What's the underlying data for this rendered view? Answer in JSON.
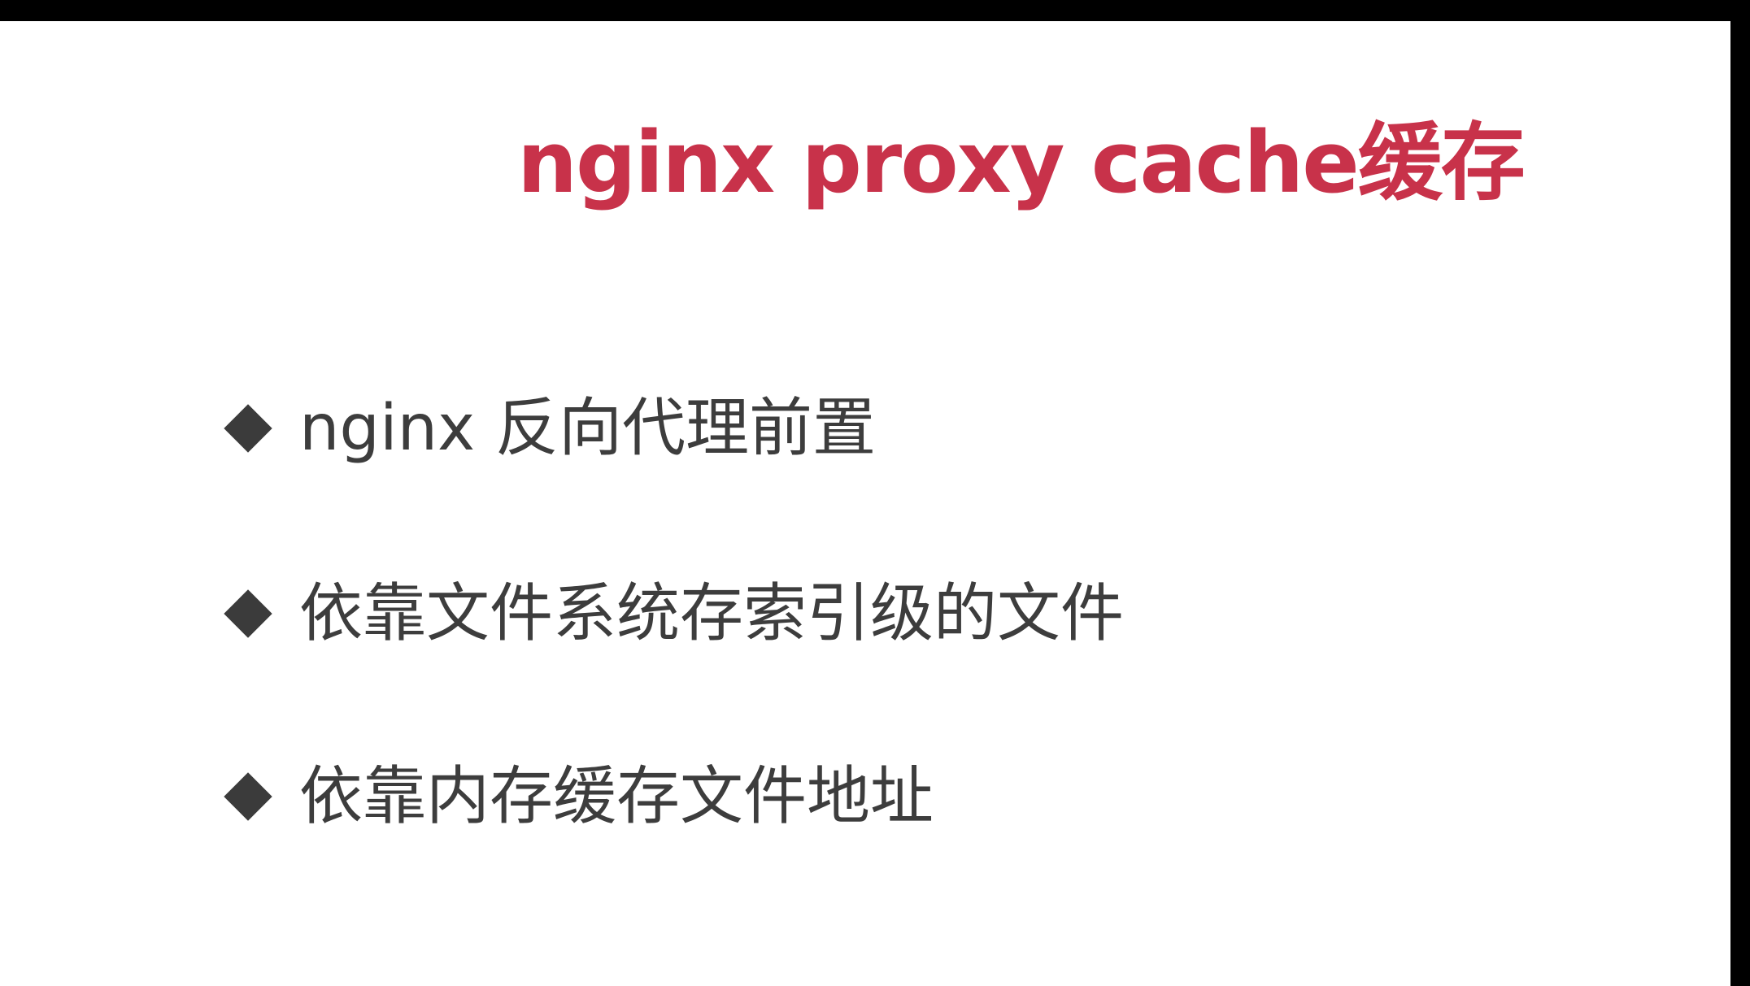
{
  "slide": {
    "title": "nginx proxy cache缓存",
    "bullets": [
      {
        "icon": "diamond-bullet-icon",
        "text": "nginx 反向代理前置"
      },
      {
        "icon": "diamond-bullet-icon",
        "text": "依靠文件系统存索引级的文件"
      },
      {
        "icon": "diamond-bullet-icon",
        "text": "依靠内存缓存文件地址"
      }
    ]
  },
  "colors": {
    "title": "#c8324a",
    "text": "#3d3d3d",
    "background": "#ffffff",
    "frame": "#000000"
  }
}
